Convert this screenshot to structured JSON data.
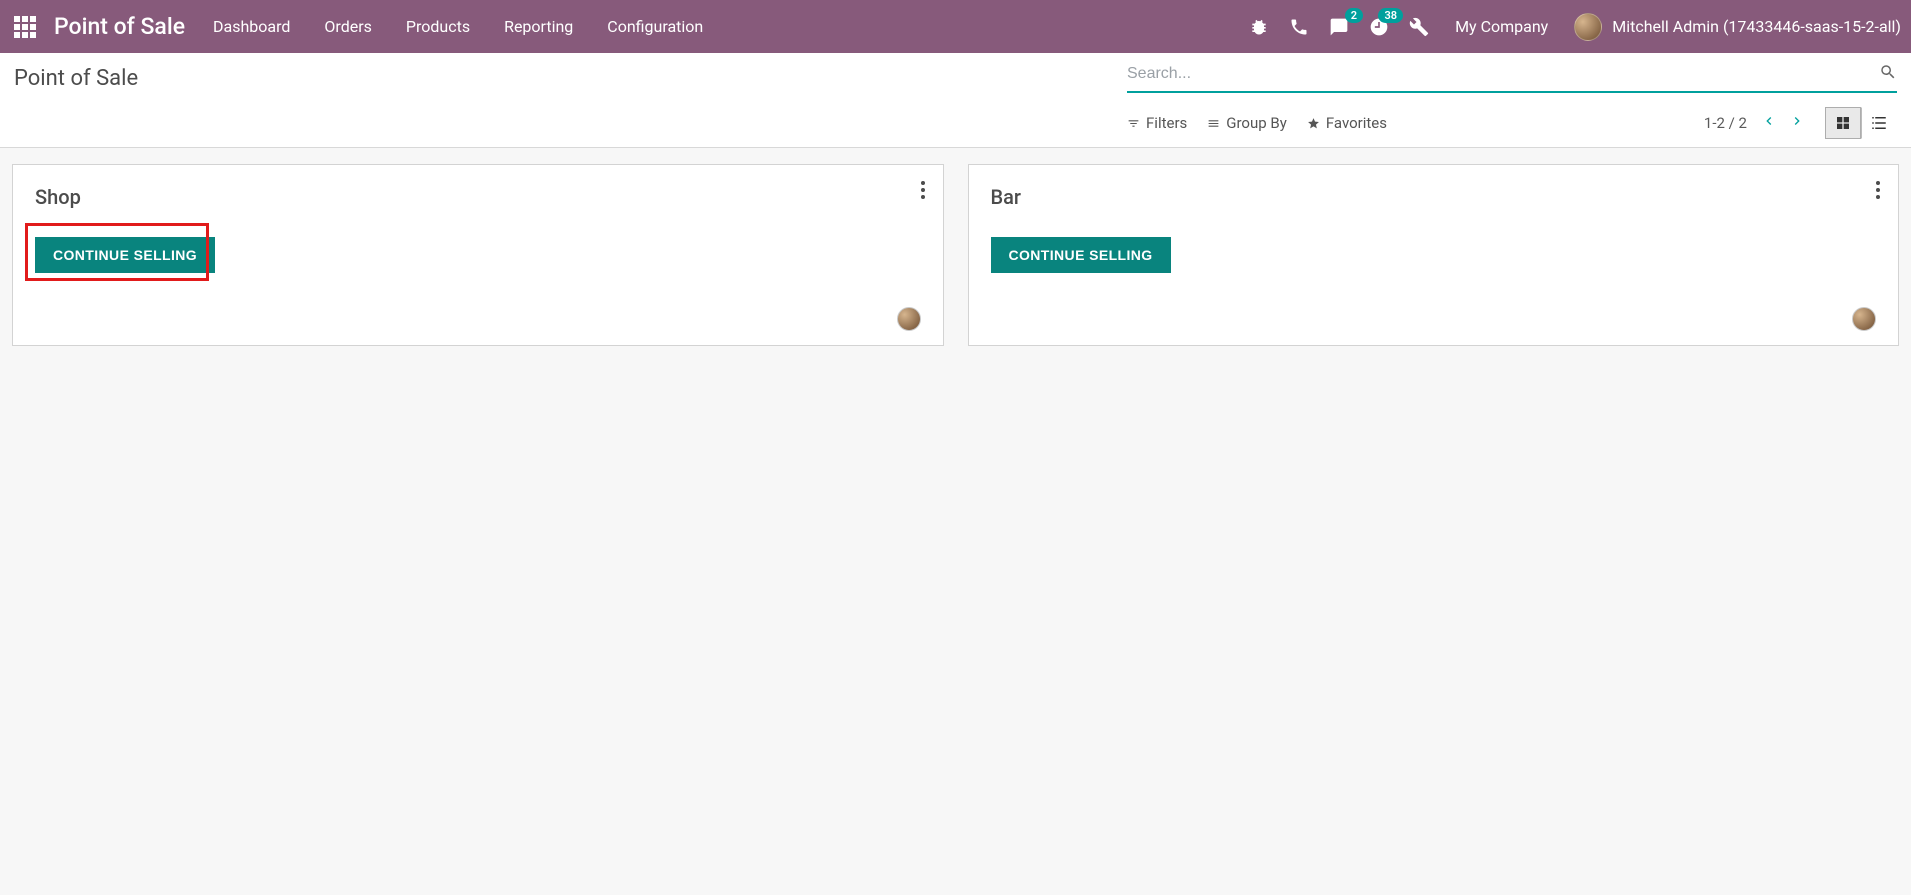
{
  "nav": {
    "brand": "Point of Sale",
    "menu": [
      "Dashboard",
      "Orders",
      "Products",
      "Reporting",
      "Configuration"
    ],
    "messages_badge": "2",
    "activities_badge": "38",
    "company": "My Company",
    "user": "Mitchell Admin (17433446-saas-15-2-all)"
  },
  "control": {
    "title": "Point of Sale",
    "search_placeholder": "Search...",
    "filters_label": "Filters",
    "groupby_label": "Group By",
    "favorites_label": "Favorites",
    "pager": "1-2 / 2"
  },
  "cards": [
    {
      "title": "Shop",
      "button": "CONTINUE SELLING",
      "highlighted": true
    },
    {
      "title": "Bar",
      "button": "CONTINUE SELLING",
      "highlighted": false
    }
  ]
}
